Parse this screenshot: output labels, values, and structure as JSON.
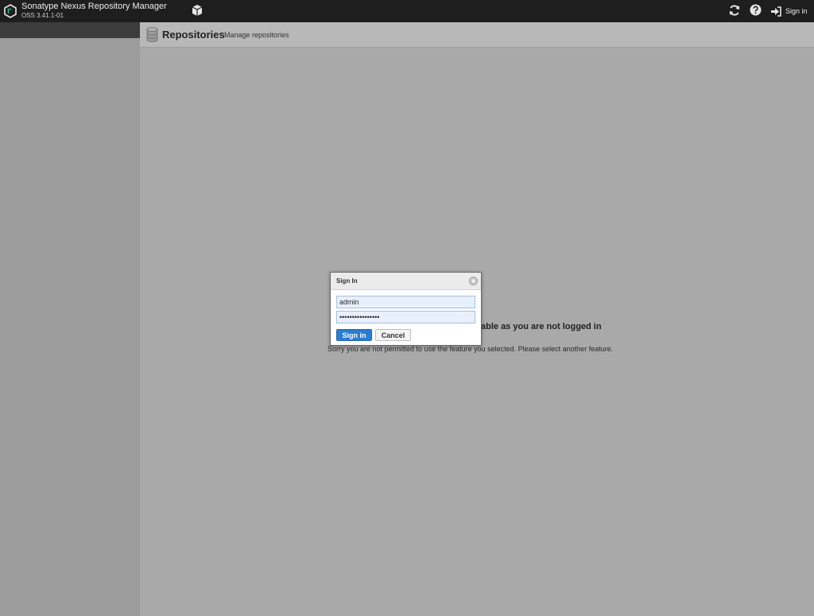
{
  "header": {
    "app_name": "Sonatype Nexus Repository Manager",
    "app_version": "OSS 3.41.1-01",
    "signin_label": "Sign in",
    "icons": [
      "nexus-logo-icon",
      "cube-icon",
      "refresh-icon",
      "help-icon",
      "sign-in-icon"
    ]
  },
  "content": {
    "title": "Repositories",
    "subtitle": "Manage repositories",
    "unavailable_title": "able as you are not logged in",
    "unavailable_text": "Sorry you are not permitted to use the feature you selected. Please select another feature."
  },
  "dialog": {
    "title": "Sign In",
    "username_value": "admin",
    "password_value": "••••••••••••••••",
    "signin_label": "Sign in",
    "cancel_label": "Cancel"
  },
  "colors": {
    "header_bg": "#1e1e1e",
    "primary_button": "#2a7dd0",
    "overlay": "#a9a9a9"
  }
}
